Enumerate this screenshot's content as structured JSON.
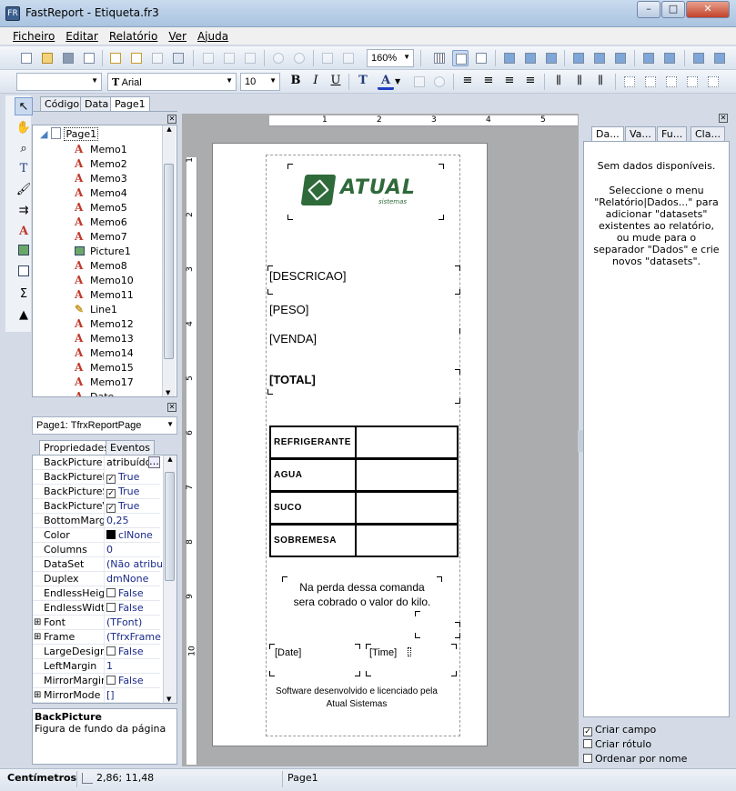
{
  "window": {
    "title": "FastReport - Etiqueta.fr3",
    "app_icon": "fastreport-icon",
    "controls": {
      "minimize": "–",
      "maximize": "□",
      "close": "✕"
    }
  },
  "menu": [
    "Ficheiro",
    "Editar",
    "Relatório",
    "Ver",
    "Ajuda"
  ],
  "toolbar1": {
    "zoom": "160%"
  },
  "toolbar2": {
    "style_combo": "",
    "font_name": "Arial",
    "font_size": "10",
    "font_icon": "T"
  },
  "editor_tabs": [
    "Código",
    "Data",
    "Page1"
  ],
  "tree": {
    "root": "Page1",
    "items": [
      {
        "type": "memo",
        "label": "Memo1"
      },
      {
        "type": "memo",
        "label": "Memo2"
      },
      {
        "type": "memo",
        "label": "Memo3"
      },
      {
        "type": "memo",
        "label": "Memo4"
      },
      {
        "type": "memo",
        "label": "Memo5"
      },
      {
        "type": "memo",
        "label": "Memo6"
      },
      {
        "type": "memo",
        "label": "Memo7"
      },
      {
        "type": "picture",
        "label": "Picture1"
      },
      {
        "type": "memo",
        "label": "Memo8"
      },
      {
        "type": "memo",
        "label": "Memo10"
      },
      {
        "type": "memo",
        "label": "Memo11"
      },
      {
        "type": "line",
        "label": "Line1"
      },
      {
        "type": "memo",
        "label": "Memo12"
      },
      {
        "type": "memo",
        "label": "Memo13"
      },
      {
        "type": "memo",
        "label": "Memo14"
      },
      {
        "type": "memo",
        "label": "Memo15"
      },
      {
        "type": "memo",
        "label": "Memo17"
      },
      {
        "type": "memo",
        "label": "Date"
      }
    ]
  },
  "object_selector": "Page1: TfrxReportPage",
  "inspector_tabs": [
    "Propriedades",
    "Eventos"
  ],
  "properties": [
    {
      "name": "BackPicture",
      "value": "atribuído)",
      "expand": false,
      "check": false,
      "button": true
    },
    {
      "name": "BackPicturePrintable",
      "value": "True",
      "expand": false,
      "check": true
    },
    {
      "name": "BackPictureStretched",
      "value": "True",
      "expand": false,
      "check": true
    },
    {
      "name": "BackPictureVisible",
      "value": "True",
      "expand": false,
      "check": true
    },
    {
      "name": "BottomMargin",
      "value": "0,25",
      "expand": false,
      "check": false
    },
    {
      "name": "Color",
      "value": "clNone",
      "expand": false,
      "check": false,
      "swatch": "#000000"
    },
    {
      "name": "Columns",
      "value": "0",
      "expand": false,
      "check": false
    },
    {
      "name": "DataSet",
      "value": "(Não atribuído)",
      "expand": false,
      "check": false
    },
    {
      "name": "Duplex",
      "value": "dmNone",
      "expand": false,
      "check": false
    },
    {
      "name": "EndlessHeight",
      "value": "False",
      "expand": false,
      "check": true,
      "unchecked": true
    },
    {
      "name": "EndlessWidth",
      "value": "False",
      "expand": false,
      "check": true,
      "unchecked": true
    },
    {
      "name": "Font",
      "value": "(TFont)",
      "expand": true,
      "check": false
    },
    {
      "name": "Frame",
      "value": "(TfrxFrame)",
      "expand": true,
      "check": false
    },
    {
      "name": "LargeDesignHeight",
      "value": "False",
      "expand": false,
      "check": true,
      "unchecked": true
    },
    {
      "name": "LeftMargin",
      "value": "1",
      "expand": false,
      "check": false
    },
    {
      "name": "MirrorMargins",
      "value": "False",
      "expand": false,
      "check": true,
      "unchecked": true
    },
    {
      "name": "MirrorMode",
      "value": "[]",
      "expand": true,
      "check": false
    }
  ],
  "hint": {
    "title": "BackPicture",
    "text": "Figura de fundo da página"
  },
  "report": {
    "logo_text": "ATUAL",
    "logo_sub": "sistemas",
    "descricao": "[DESCRICAO]",
    "peso": "[PESO]",
    "venda": "[VENDA]",
    "total": "[TOTAL]",
    "table": [
      "REFRIGERANTE",
      "AGUA",
      "SUCO",
      "SOBREMESA"
    ],
    "notice_line1": "Na perda dessa comanda",
    "notice_line2": "sera cobrado o valor do kilo.",
    "date": "[Date]",
    "time": "[Time]",
    "footer_line1": "Software desenvolvido e licenciado pela",
    "footer_line2": "Atual Sistemas"
  },
  "ruler_h": [
    "1",
    "2",
    "3",
    "4",
    "5"
  ],
  "ruler_v": [
    "1",
    "2",
    "3",
    "4",
    "5",
    "6",
    "7",
    "8",
    "9",
    "10"
  ],
  "data_tabs": [
    "Da...",
    "Va...",
    "Fu...",
    "Cla..."
  ],
  "data_panel": {
    "line1": "Sem dados disponíveis.",
    "line2": "Seleccione o menu \"Relatório|Dados...\" para adicionar \"datasets\" existentes ao relatório, ou mude para o separador \"Dados\" e crie novos \"datasets\"."
  },
  "data_options": [
    {
      "label": "Criar campo",
      "checked": true
    },
    {
      "label": "Criar rótulo",
      "checked": false
    },
    {
      "label": "Ordenar por nome",
      "checked": false
    }
  ],
  "status": {
    "units": "Centímetros",
    "coords": "2,86; 11,48",
    "page": "Page1"
  }
}
